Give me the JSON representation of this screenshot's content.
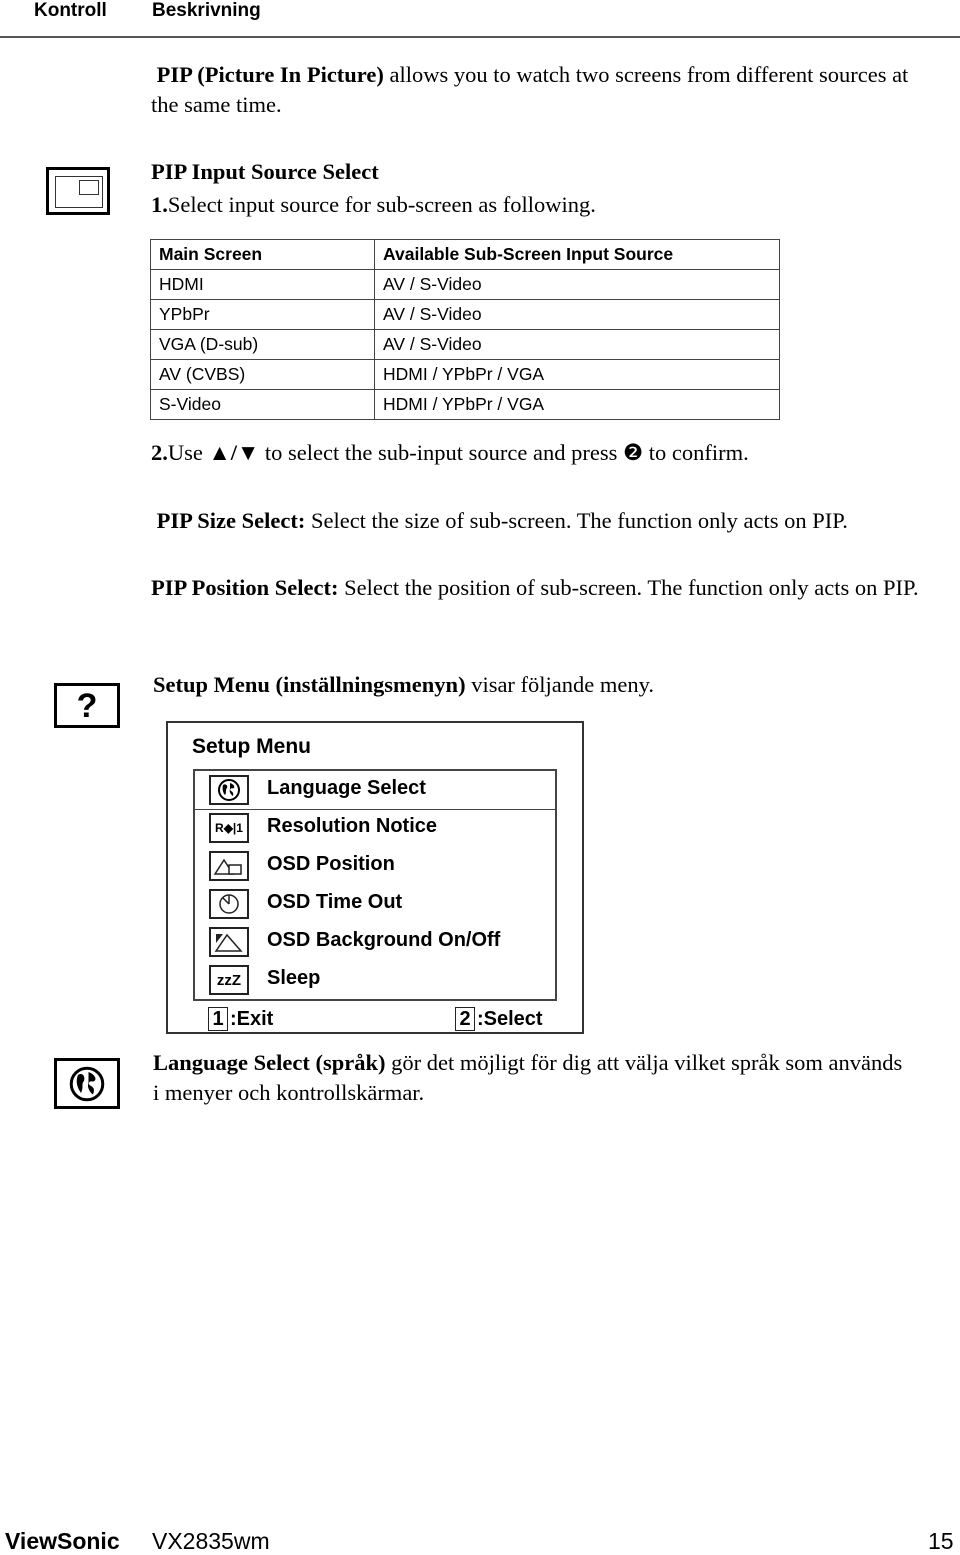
{
  "header": {
    "col_control": "Kontroll",
    "col_description": "Beskrivning"
  },
  "pip_intro": {
    "bold": "PIP (Picture In Picture)",
    "text": " allows you to watch two screens from different sources at the same time."
  },
  "pip_input": {
    "title": "PIP Input Source Select",
    "step1_num": "1.",
    "step1_text": "Select input source for sub-screen as following.",
    "table": {
      "headers": [
        "Main Screen",
        "Available Sub-Screen Input Source"
      ],
      "rows": [
        [
          "HDMI",
          "AV / S-Video"
        ],
        [
          "YPbPr",
          "AV / S-Video"
        ],
        [
          "VGA (D-sub)",
          "AV / S-Video"
        ],
        [
          "AV (CVBS)",
          "HDMI / YPbPr / VGA"
        ],
        [
          "S-Video",
          "HDMI / YPbPr / VGA"
        ]
      ]
    },
    "step2_num": "2.",
    "step2_pre": "Use ",
    "step2_arrows": "▲/▼",
    "step2_mid": " to select the sub-input source and press ",
    "step2_key": "❷",
    "step2_post": " to confirm."
  },
  "pip_size": {
    "bold": "PIP Size Select:",
    "text": " Select the size of sub-screen. The function only acts on PIP."
  },
  "pip_position": {
    "bold": "PIP Position Select:",
    "text": " Select the position of sub-screen. The function only acts on PIP."
  },
  "setup": {
    "icon_glyph": "?",
    "bold": "Setup Menu (inställningsmenyn)",
    "text": " visar följande meny."
  },
  "osd_menu": {
    "title": "Setup Menu",
    "items": [
      {
        "icon": "globe-icon",
        "label": "Language Select"
      },
      {
        "icon": "resolution-notice-icon",
        "label": "Resolution Notice",
        "glyph": "R◆|1"
      },
      {
        "icon": "osd-position-icon",
        "label": "OSD Position"
      },
      {
        "icon": "clock-icon",
        "label": "OSD Time Out"
      },
      {
        "icon": "background-icon",
        "label": "OSD Background On/Off"
      },
      {
        "icon": "sleep-icon",
        "label": "Sleep",
        "glyph": "zzZ"
      }
    ],
    "exit_key": "1",
    "exit_label": ":Exit",
    "select_key": "2",
    "select_label": ":Select"
  },
  "language": {
    "bold": "Language Select (språk)",
    "text": " gör det möjligt för dig att välja vilket språk som används i menyer och kontrollskärmar."
  },
  "footer": {
    "brand": "ViewSonic",
    "model": "VX2835wm",
    "page": "15"
  }
}
